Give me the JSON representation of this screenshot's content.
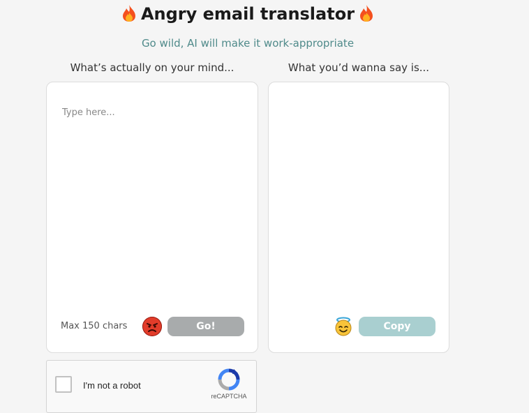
{
  "header": {
    "title": "Angry email translator",
    "subtitle": "Go wild, AI will make it work-appropriate",
    "title_icon": "fire-emoji"
  },
  "input_panel": {
    "label": "What’s actually on your mind...",
    "placeholder": "Type here...",
    "value": "",
    "char_limit_text": "Max 150 chars",
    "emoji": "angry-face-emoji",
    "submit_label": "Go!"
  },
  "output_panel": {
    "label": "What you’d wanna say is...",
    "value": "",
    "emoji": "angel-face-emoji",
    "copy_label": "Copy"
  },
  "captcha": {
    "checkbox_label": "I'm not a robot",
    "brand": "reCAPTCHA"
  },
  "colors": {
    "subtitle": "#4f8a8a",
    "go_button": "#a8abac",
    "copy_button": "#a9cfd0",
    "panel_bg": "#ffffff",
    "page_bg": "#f5f5f5"
  }
}
